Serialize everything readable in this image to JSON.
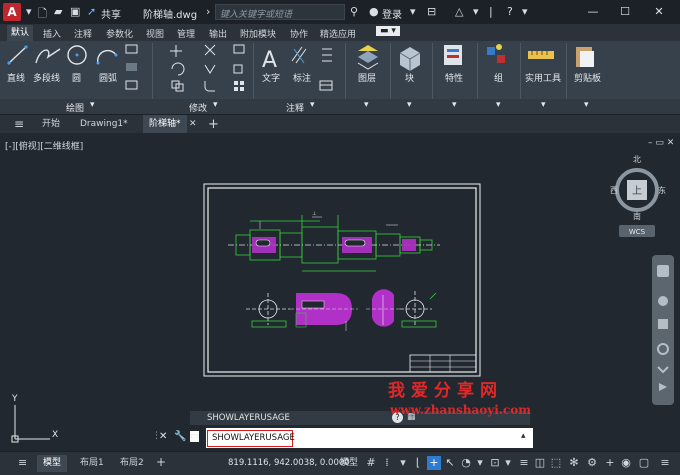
{
  "titlebar": {
    "app_letter": "A",
    "share_label": "共享",
    "file_name": "阶梯轴.dwg",
    "search_placeholder": "键入关键字或短语",
    "login_label": "登录"
  },
  "menubar": {
    "tabs": [
      "默认",
      "插入",
      "注释",
      "参数化",
      "视图",
      "管理",
      "输出",
      "附加模块",
      "协作",
      "精选应用"
    ]
  },
  "ribbon": {
    "draw": {
      "line": "直线",
      "polyline": "多段线",
      "circle": "圆",
      "arc": "圆弧",
      "panel": "绘图"
    },
    "modify": {
      "panel": "修改"
    },
    "annotation": {
      "text": "文字",
      "dimension": "标注",
      "panel": "注释"
    },
    "layers": "图层",
    "block": "块",
    "properties": "特性",
    "group": "组",
    "utilities": "实用工具",
    "clipboard": "剪贴板"
  },
  "filetabs": {
    "start": "开始",
    "drawing1": "Drawing1*",
    "current": "阶梯轴*"
  },
  "viewport": {
    "label": "[-][俯视][二维线框]",
    "viewcube": {
      "north": "北",
      "south": "南",
      "east": "东",
      "west": "西",
      "top": "上",
      "wcs": "WCS"
    },
    "ucs_y": "Y",
    "ucs_x": "X"
  },
  "command": {
    "history": "SHOWLAYERUSAGE",
    "input": "SHOWLAYERUSAGE"
  },
  "watermark": {
    "line1": "我爱分享网",
    "line2": "www.zhanshaoyi.com"
  },
  "statusbar": {
    "model_tab": "模型",
    "layout1": "布局1",
    "layout2": "布局2",
    "coords": "819.1116, 942.0038, 0.0000",
    "model_label": "模型"
  },
  "colors": {
    "accent": "#2d7ccf",
    "drawing_green": "#35d23a",
    "hatch_magenta": "#b030c8",
    "watermark_red": "#e02828"
  }
}
